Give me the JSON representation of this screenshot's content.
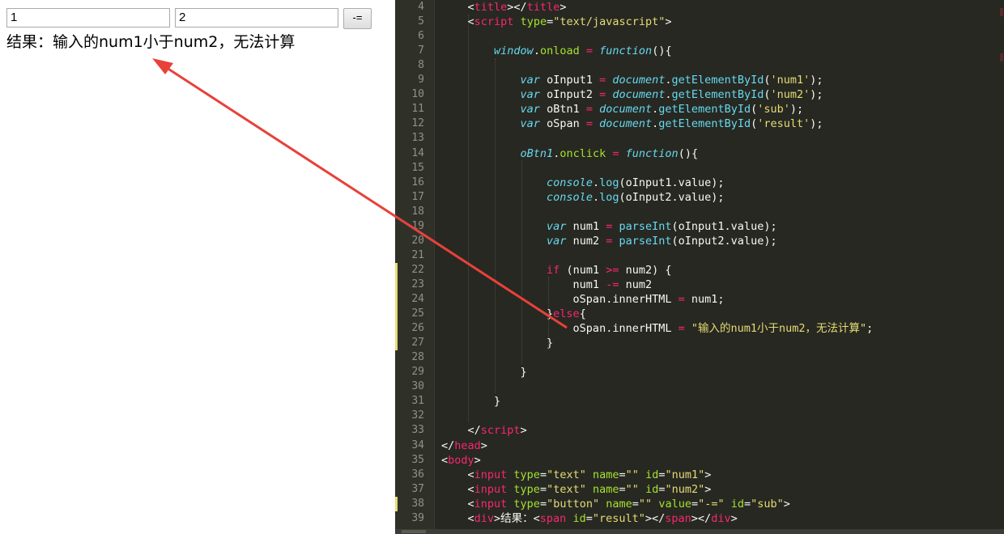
{
  "browser": {
    "input1_value": "1",
    "input2_value": "2",
    "button_label": "-=",
    "result_text": "结果：输入的num1小于num2，无法计算"
  },
  "editor": {
    "theme_colors": {
      "background": "#272822",
      "keyword": "#f92672",
      "string": "#e6db74",
      "function": "#66d9ef",
      "attribute": "#a6e22e",
      "text": "#f8f8f2",
      "line_number": "#90908a"
    },
    "lines": [
      {
        "number": "4",
        "tokens": [
          [
            "    ",
            "#f8f8f2"
          ],
          [
            "<",
            "#f8f8f2"
          ],
          [
            "title",
            "#f92672"
          ],
          [
            "></",
            "#f8f8f2"
          ],
          [
            "title",
            "#f92672"
          ],
          [
            ">",
            "#f8f8f2"
          ]
        ]
      },
      {
        "number": "5",
        "tokens": [
          [
            "    <",
            "#f8f8f2"
          ],
          [
            "script",
            "#f92672"
          ],
          [
            " ",
            "#f8f8f2"
          ],
          [
            "type",
            "#a6e22e"
          ],
          [
            "=",
            "#f8f8f2"
          ],
          [
            "\"text/javascript\"",
            "#e6db74"
          ],
          [
            ">",
            "#f8f8f2"
          ]
        ]
      },
      {
        "number": "6",
        "tokens": []
      },
      {
        "number": "7",
        "tokens": [
          [
            "        ",
            "#f8f8f2"
          ],
          [
            "window",
            "#66d9ef"
          ],
          [
            ".",
            "#f8f8f2"
          ],
          [
            "onload",
            "#a6e22e"
          ],
          [
            " ",
            "#f8f8f2"
          ],
          [
            "=",
            "#f92672"
          ],
          [
            " ",
            "#f8f8f2"
          ],
          [
            "function",
            "#66d9ef"
          ],
          [
            "(){",
            "#f8f8f2"
          ]
        ]
      },
      {
        "number": "8",
        "tokens": []
      },
      {
        "number": "9",
        "tokens": [
          [
            "            ",
            "#f8f8f2"
          ],
          [
            "var",
            "#66d9ef"
          ],
          [
            " oInput1 ",
            "#f8f8f2"
          ],
          [
            "=",
            "#f92672"
          ],
          [
            " ",
            "#f8f8f2"
          ],
          [
            "document",
            "#66d9ef"
          ],
          [
            ".",
            "#f8f8f2"
          ],
          [
            "getElementById",
            "#66d9ef"
          ],
          [
            "(",
            "#f8f8f2"
          ],
          [
            "'num1'",
            "#e6db74"
          ],
          [
            ");",
            "#f8f8f2"
          ]
        ]
      },
      {
        "number": "10",
        "tokens": [
          [
            "            ",
            "#f8f8f2"
          ],
          [
            "var",
            "#66d9ef"
          ],
          [
            " oInput2 ",
            "#f8f8f2"
          ],
          [
            "=",
            "#f92672"
          ],
          [
            " ",
            "#f8f8f2"
          ],
          [
            "document",
            "#66d9ef"
          ],
          [
            ".",
            "#f8f8f2"
          ],
          [
            "getElementById",
            "#66d9ef"
          ],
          [
            "(",
            "#f8f8f2"
          ],
          [
            "'num2'",
            "#e6db74"
          ],
          [
            ");",
            "#f8f8f2"
          ]
        ]
      },
      {
        "number": "11",
        "tokens": [
          [
            "            ",
            "#f8f8f2"
          ],
          [
            "var",
            "#66d9ef"
          ],
          [
            " oBtn1 ",
            "#f8f8f2"
          ],
          [
            "=",
            "#f92672"
          ],
          [
            " ",
            "#f8f8f2"
          ],
          [
            "document",
            "#66d9ef"
          ],
          [
            ".",
            "#f8f8f2"
          ],
          [
            "getElementById",
            "#66d9ef"
          ],
          [
            "(",
            "#f8f8f2"
          ],
          [
            "'sub'",
            "#e6db74"
          ],
          [
            ");",
            "#f8f8f2"
          ]
        ]
      },
      {
        "number": "12",
        "tokens": [
          [
            "            ",
            "#f8f8f2"
          ],
          [
            "var",
            "#66d9ef"
          ],
          [
            " oSpan ",
            "#f8f8f2"
          ],
          [
            "=",
            "#f92672"
          ],
          [
            " ",
            "#f8f8f2"
          ],
          [
            "document",
            "#66d9ef"
          ],
          [
            ".",
            "#f8f8f2"
          ],
          [
            "getElementById",
            "#66d9ef"
          ],
          [
            "(",
            "#f8f8f2"
          ],
          [
            "'result'",
            "#e6db74"
          ],
          [
            ");",
            "#f8f8f2"
          ]
        ]
      },
      {
        "number": "13",
        "tokens": []
      },
      {
        "number": "14",
        "tokens": [
          [
            "            ",
            "#f8f8f2"
          ],
          [
            "oBtn1",
            "#66d9ef"
          ],
          [
            ".",
            "#f8f8f2"
          ],
          [
            "onclick",
            "#a6e22e"
          ],
          [
            " ",
            "#f8f8f2"
          ],
          [
            "=",
            "#f92672"
          ],
          [
            " ",
            "#f8f8f2"
          ],
          [
            "function",
            "#66d9ef"
          ],
          [
            "(){",
            "#f8f8f2"
          ]
        ]
      },
      {
        "number": "15",
        "tokens": []
      },
      {
        "number": "16",
        "tokens": [
          [
            "                ",
            "#f8f8f2"
          ],
          [
            "console",
            "#66d9ef"
          ],
          [
            ".",
            "#f8f8f2"
          ],
          [
            "log",
            "#66d9ef"
          ],
          [
            "(oInput1.value);",
            "#f8f8f2"
          ]
        ]
      },
      {
        "number": "17",
        "tokens": [
          [
            "                ",
            "#f8f8f2"
          ],
          [
            "console",
            "#66d9ef"
          ],
          [
            ".",
            "#f8f8f2"
          ],
          [
            "log",
            "#66d9ef"
          ],
          [
            "(oInput2.value);",
            "#f8f8f2"
          ]
        ]
      },
      {
        "number": "18",
        "tokens": []
      },
      {
        "number": "19",
        "tokens": [
          [
            "                ",
            "#f8f8f2"
          ],
          [
            "var",
            "#66d9ef"
          ],
          [
            " num1 ",
            "#f8f8f2"
          ],
          [
            "=",
            "#f92672"
          ],
          [
            " ",
            "#f8f8f2"
          ],
          [
            "parseInt",
            "#66d9ef"
          ],
          [
            "(oInput1.value);",
            "#f8f8f2"
          ]
        ]
      },
      {
        "number": "20",
        "tokens": [
          [
            "                ",
            "#f8f8f2"
          ],
          [
            "var",
            "#66d9ef"
          ],
          [
            " num2 ",
            "#f8f8f2"
          ],
          [
            "=",
            "#f92672"
          ],
          [
            " ",
            "#f8f8f2"
          ],
          [
            "parseInt",
            "#66d9ef"
          ],
          [
            "(oInput2.value);",
            "#f8f8f2"
          ]
        ]
      },
      {
        "number": "21",
        "tokens": []
      },
      {
        "number": "22",
        "tokens": [
          [
            "                ",
            "#f8f8f2"
          ],
          [
            "if",
            "#f92672"
          ],
          [
            " (num1 ",
            "#f8f8f2"
          ],
          [
            ">=",
            "#f92672"
          ],
          [
            " num2) {",
            "#f8f8f2"
          ]
        ]
      },
      {
        "number": "23",
        "tokens": [
          [
            "                    num1 ",
            "#f8f8f2"
          ],
          [
            "-=",
            "#f92672"
          ],
          [
            " num2",
            "#f8f8f2"
          ]
        ]
      },
      {
        "number": "24",
        "tokens": [
          [
            "                    oSpan.innerHTML ",
            "#f8f8f2"
          ],
          [
            "=",
            "#f92672"
          ],
          [
            " num1;",
            "#f8f8f2"
          ]
        ]
      },
      {
        "number": "25",
        "tokens": [
          [
            "                }",
            "#f8f8f2"
          ],
          [
            "else",
            "#f92672"
          ],
          [
            "{",
            "#f8f8f2"
          ]
        ]
      },
      {
        "number": "26",
        "tokens": [
          [
            "                    oSpan.innerHTML ",
            "#f8f8f2"
          ],
          [
            "=",
            "#f92672"
          ],
          [
            " ",
            "#f8f8f2"
          ],
          [
            "\"输入的num1小于num2，无法计算\"",
            "#e6db74"
          ],
          [
            ";",
            "#f8f8f2"
          ]
        ]
      },
      {
        "number": "27",
        "tokens": [
          [
            "                }",
            "#f8f8f2"
          ]
        ]
      },
      {
        "number": "28",
        "tokens": []
      },
      {
        "number": "29",
        "tokens": [
          [
            "            }",
            "#f8f8f2"
          ]
        ]
      },
      {
        "number": "30",
        "tokens": []
      },
      {
        "number": "31",
        "tokens": [
          [
            "        }",
            "#f8f8f2"
          ]
        ]
      },
      {
        "number": "32",
        "tokens": []
      },
      {
        "number": "33",
        "tokens": [
          [
            "    </",
            "#f8f8f2"
          ],
          [
            "script",
            "#f92672"
          ],
          [
            ">",
            "#f8f8f2"
          ]
        ]
      },
      {
        "number": "34",
        "tokens": [
          [
            "</",
            "#f8f8f2"
          ],
          [
            "head",
            "#f92672"
          ],
          [
            ">",
            "#f8f8f2"
          ]
        ]
      },
      {
        "number": "35",
        "tokens": [
          [
            "<",
            "#f8f8f2"
          ],
          [
            "body",
            "#f92672"
          ],
          [
            ">",
            "#f8f8f2"
          ]
        ]
      },
      {
        "number": "36",
        "tokens": [
          [
            "    <",
            "#f8f8f2"
          ],
          [
            "input",
            "#f92672"
          ],
          [
            " ",
            "#f8f8f2"
          ],
          [
            "type",
            "#a6e22e"
          ],
          [
            "=",
            "#f8f8f2"
          ],
          [
            "\"text\"",
            "#e6db74"
          ],
          [
            " ",
            "#f8f8f2"
          ],
          [
            "name",
            "#a6e22e"
          ],
          [
            "=",
            "#f8f8f2"
          ],
          [
            "\"\"",
            "#e6db74"
          ],
          [
            " ",
            "#f8f8f2"
          ],
          [
            "id",
            "#a6e22e"
          ],
          [
            "=",
            "#f8f8f2"
          ],
          [
            "\"num1\"",
            "#e6db74"
          ],
          [
            ">",
            "#f8f8f2"
          ]
        ]
      },
      {
        "number": "37",
        "tokens": [
          [
            "    <",
            "#f8f8f2"
          ],
          [
            "input",
            "#f92672"
          ],
          [
            " ",
            "#f8f8f2"
          ],
          [
            "type",
            "#a6e22e"
          ],
          [
            "=",
            "#f8f8f2"
          ],
          [
            "\"text\"",
            "#e6db74"
          ],
          [
            " ",
            "#f8f8f2"
          ],
          [
            "name",
            "#a6e22e"
          ],
          [
            "=",
            "#f8f8f2"
          ],
          [
            "\"\"",
            "#e6db74"
          ],
          [
            " ",
            "#f8f8f2"
          ],
          [
            "id",
            "#a6e22e"
          ],
          [
            "=",
            "#f8f8f2"
          ],
          [
            "\"num2\"",
            "#e6db74"
          ],
          [
            ">",
            "#f8f8f2"
          ]
        ]
      },
      {
        "number": "38",
        "tokens": [
          [
            "    <",
            "#f8f8f2"
          ],
          [
            "input",
            "#f92672"
          ],
          [
            " ",
            "#f8f8f2"
          ],
          [
            "type",
            "#a6e22e"
          ],
          [
            "=",
            "#f8f8f2"
          ],
          [
            "\"button\"",
            "#e6db74"
          ],
          [
            " ",
            "#f8f8f2"
          ],
          [
            "name",
            "#a6e22e"
          ],
          [
            "=",
            "#f8f8f2"
          ],
          [
            "\"\"",
            "#e6db74"
          ],
          [
            " ",
            "#f8f8f2"
          ],
          [
            "value",
            "#a6e22e"
          ],
          [
            "=",
            "#f8f8f2"
          ],
          [
            "\"-=\"",
            "#e6db74"
          ],
          [
            " ",
            "#f8f8f2"
          ],
          [
            "id",
            "#a6e22e"
          ],
          [
            "=",
            "#f8f8f2"
          ],
          [
            "\"sub\"",
            "#e6db74"
          ],
          [
            ">",
            "#f8f8f2"
          ]
        ]
      },
      {
        "number": "39",
        "tokens": [
          [
            "    <",
            "#f8f8f2"
          ],
          [
            "div",
            "#f92672"
          ],
          [
            ">结果：<",
            "#f8f8f2"
          ],
          [
            "span",
            "#f92672"
          ],
          [
            " ",
            "#f8f8f2"
          ],
          [
            "id",
            "#a6e22e"
          ],
          [
            "=",
            "#f8f8f2"
          ],
          [
            "\"result\"",
            "#e6db74"
          ],
          [
            "></",
            "#f8f8f2"
          ],
          [
            "span",
            "#f92672"
          ],
          [
            "></",
            "#f8f8f2"
          ],
          [
            "div",
            "#f92672"
          ],
          [
            ">",
            "#f8f8f2"
          ]
        ]
      }
    ],
    "modified_lines": [
      "22",
      "23",
      "24",
      "25",
      "26",
      "27",
      "38"
    ]
  },
  "annotation": {
    "arrow_color": "#e8413a"
  }
}
